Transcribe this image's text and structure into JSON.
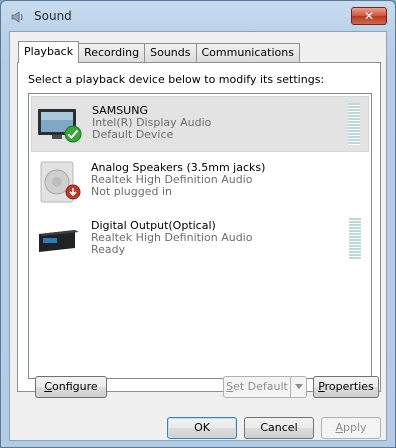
{
  "window": {
    "title": "Sound",
    "close_label": "✕"
  },
  "tabs": [
    {
      "label": "Playback",
      "active": true
    },
    {
      "label": "Recording",
      "active": false
    },
    {
      "label": "Sounds",
      "active": false
    },
    {
      "label": "Communications",
      "active": false
    }
  ],
  "playback": {
    "instruction": "Select a playback device below to modify its settings:",
    "devices": [
      {
        "name": "SAMSUNG",
        "line2": "Intel(R) Display Audio",
        "line3": "Default Device",
        "icon": "monitor-icon",
        "status_icon": "checkmark-icon",
        "selected": true
      },
      {
        "name": "Analog Speakers (3.5mm jacks)",
        "line2": "Realtek High Definition Audio",
        "line3": "Not plugged in",
        "icon": "speaker-icon",
        "status_icon": "unplugged-icon",
        "selected": false
      },
      {
        "name": "Digital Output(Optical)",
        "line2": "Realtek High Definition Audio",
        "line3": "Ready",
        "icon": "receiver-icon",
        "status_icon": null,
        "selected": false
      }
    ]
  },
  "buttons": {
    "configure": {
      "prefix": "",
      "accel": "C",
      "suffix": "onfigure"
    },
    "set_default": {
      "prefix": "",
      "accel": "S",
      "suffix": "et Default"
    },
    "properties": {
      "prefix": "",
      "accel": "P",
      "suffix": "roperties"
    },
    "ok": "OK",
    "cancel": "Cancel",
    "apply": {
      "prefix": "",
      "accel": "A",
      "suffix": "pply"
    }
  }
}
